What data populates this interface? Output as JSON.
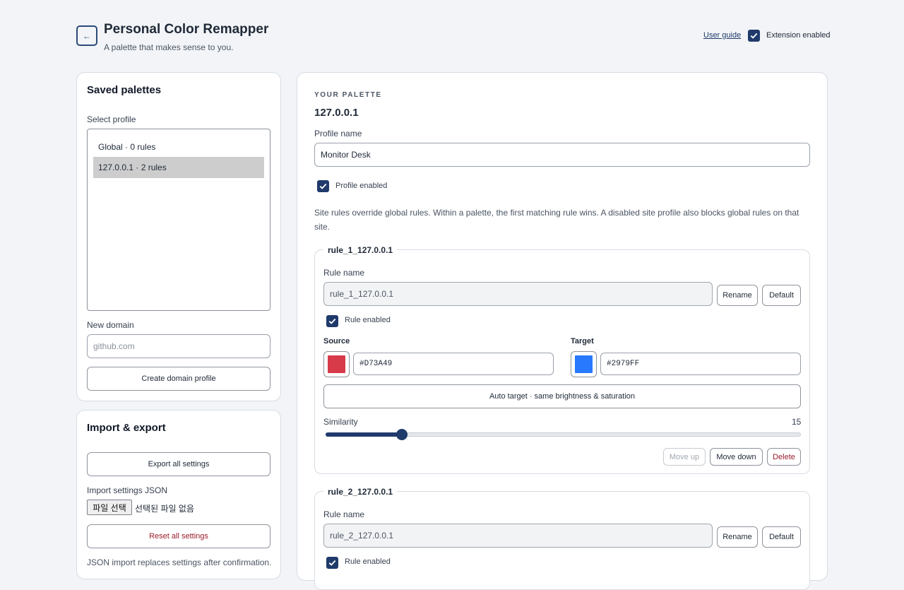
{
  "header": {
    "back_icon": "←",
    "title": "Personal Color Remapper",
    "subtitle": "A palette that makes sense to you.",
    "user_guide": "User guide",
    "extension_enabled": "Extension enabled"
  },
  "saved": {
    "title": "Saved palettes",
    "select_label": "Select profile",
    "profiles": [
      "Global · 0 rules",
      "127.0.0.1 · 2 rules"
    ],
    "new_domain_label": "New domain",
    "new_domain_placeholder": "github.com",
    "create_button": "Create domain profile"
  },
  "import_export": {
    "title": "Import & export",
    "export_button": "Export all settings",
    "import_label": "Import settings JSON",
    "file_button": "파일 선택",
    "file_status": "선택된 파일 없음",
    "reset_button": "Reset all settings",
    "note": "JSON import replaces settings after confirmation."
  },
  "palette": {
    "eyebrow": "YOUR PALETTE",
    "host": "127.0.0.1",
    "profile_name_label": "Profile name",
    "profile_name_value": "Monitor Desk",
    "profile_enabled": "Profile enabled",
    "note": "Site rules override global rules. Within a palette, the first matching rule wins. A disabled site profile also blocks global rules on that site."
  },
  "rules": [
    {
      "legend": "rule_1_127.0.0.1",
      "name_label": "Rule name",
      "name_value": "rule_1_127.0.0.1",
      "rename": "Rename",
      "default": "Default",
      "enabled": "Rule enabled",
      "source_label": "Source",
      "source_hex": "#D73A49",
      "target_label": "Target",
      "target_hex": "#2979FF",
      "auto_target": "Auto target · same brightness & saturation",
      "similarity_label": "Similarity",
      "similarity_value": "15",
      "similarity_fraction": 0.16,
      "move_up": "Move up",
      "move_down": "Move down",
      "delete": "Delete"
    },
    {
      "legend": "rule_2_127.0.0.1",
      "name_label": "Rule name",
      "name_value": "rule_2_127.0.0.1",
      "rename": "Rename",
      "default": "Default",
      "enabled": "Rule enabled"
    }
  ],
  "colors": {
    "accent": "#1f3a6b",
    "danger": "#9b1c2c",
    "background": "#f2f4f7"
  }
}
